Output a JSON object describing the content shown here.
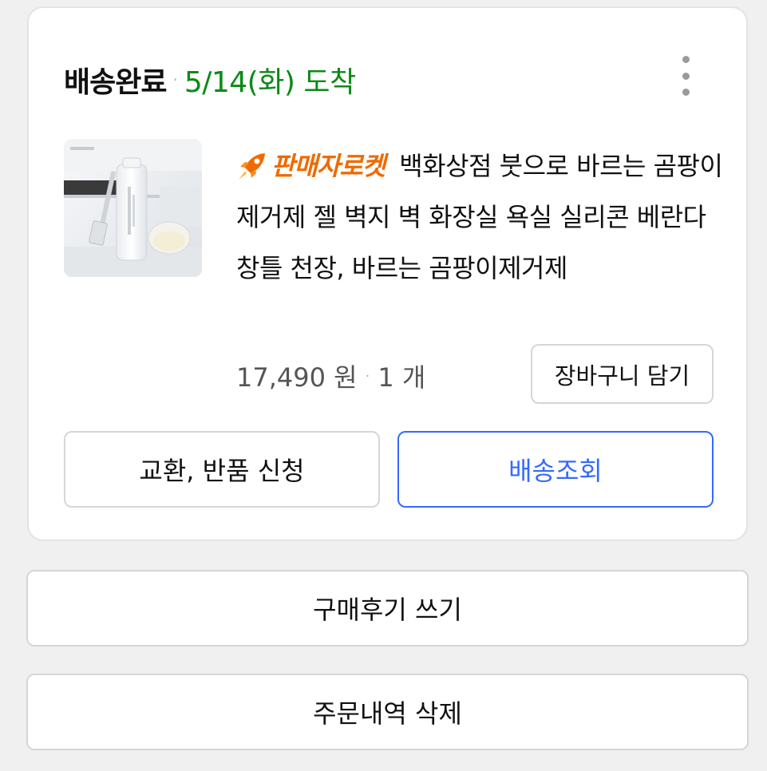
{
  "order": {
    "status": "배송완료",
    "arrival": "5/14(화) 도착",
    "more_menu_icon": "kebab-vertical-icon"
  },
  "product": {
    "badge": "판매자로켓",
    "badge_icon": "rocket-icon",
    "badge_color": "#f06a00",
    "name": "백화상점 붓으로 바르는 곰팡이 제거제 젤 벽지 벽 화장실 욕실 실리콘 베란다 창틀 천장, 바르는 곰팡이제거제",
    "price": "17,490 원",
    "quantity": "1 개",
    "add_to_cart_label": "장바구니 담기"
  },
  "actions": {
    "exchange_return_label": "교환, 반품 신청",
    "track_delivery_label": "배송조회",
    "write_review_label": "구매후기 쓰기",
    "delete_order_label": "주문내역 삭제"
  },
  "colors": {
    "arrival_green": "#0a8a17",
    "accent_blue": "#346aff"
  }
}
